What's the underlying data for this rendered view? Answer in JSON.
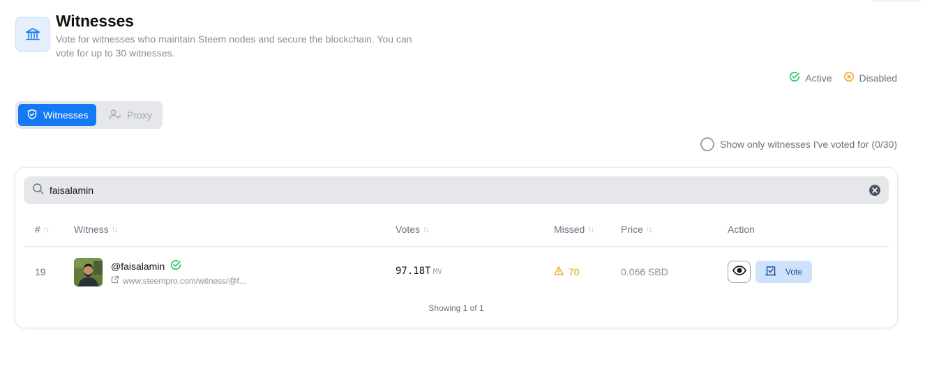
{
  "header": {
    "icon": "bank-icon",
    "title": "Witnesses",
    "description": "Vote for witnesses who maintain Steem nodes and secure the blockchain. You can vote for up to 30 witnesses."
  },
  "legend": {
    "active_label": "Active",
    "active_color": "#22c55e",
    "disabled_label": "Disabled",
    "disabled_color": "#f5a524"
  },
  "tabs": [
    {
      "label": "Witnesses",
      "icon": "shield-icon",
      "selected": true
    },
    {
      "label": "Proxy",
      "icon": "user-check-icon",
      "selected": false
    }
  ],
  "filter": {
    "label": "Show only witnesses I've voted for (0/30)",
    "checked": false
  },
  "search": {
    "value": "faisalamin",
    "placeholder": ""
  },
  "table": {
    "columns": [
      "#",
      "Witness",
      "Votes",
      "Missed",
      "Price",
      "Action"
    ],
    "rows": [
      {
        "rank": "19",
        "name": "@faisalamin",
        "status": "active",
        "url": "www.steempro.com/witness/@f...",
        "votes": "97.18T",
        "votes_unit": "MV",
        "missed": "70",
        "price": "0.066 SBD",
        "vote_label": "Vote"
      }
    ],
    "pagination": "Showing 1 of 1"
  },
  "colors": {
    "accent": "#1479f5",
    "vote_button_bg": "#cfe2fb",
    "warning": "#e0a100"
  }
}
